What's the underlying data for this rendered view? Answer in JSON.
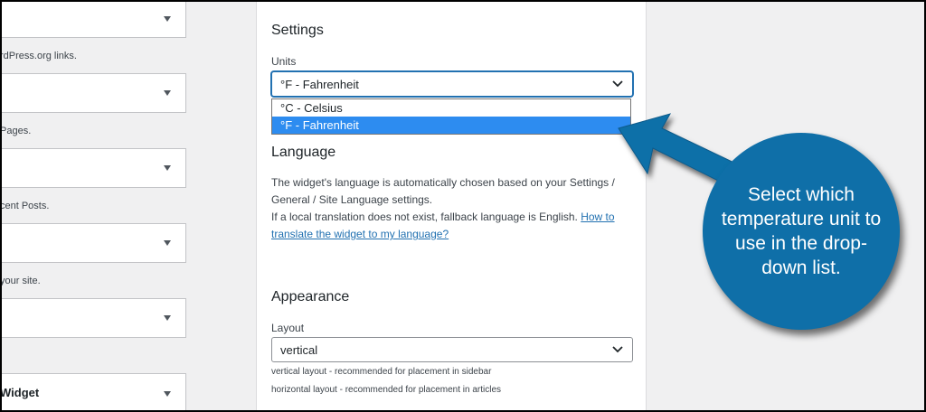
{
  "widget_list": {
    "descriptions": [
      "rdPress.org links.",
      " Pages.",
      "cent Posts.",
      "your site."
    ],
    "last_widget_title": "Widget"
  },
  "settings": {
    "heading": "Settings",
    "units_label": "Units",
    "units_selected": "°F - Fahrenheit",
    "unit_options": [
      "°C - Celsius",
      "°F - Fahrenheit"
    ]
  },
  "language": {
    "heading": "Language",
    "text_1": "The widget's language is automatically chosen based on your Settings / General / Site Language settings.",
    "text_2": "If a local translation does not exist, fallback language is English.",
    "link": "How to translate the widget to my language?"
  },
  "appearance": {
    "heading": "Appearance",
    "layout_label": "Layout",
    "layout_selected": "vertical",
    "hint_vertical": "vertical layout - recommended for placement in sidebar",
    "hint_horizontal": "horizontal layout - recommended for placement in articles"
  },
  "callout": {
    "text": "Select which temperature unit to use in the drop-down list.",
    "color": "#0f6fa8"
  }
}
